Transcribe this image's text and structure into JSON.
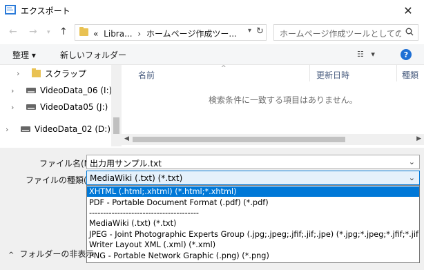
{
  "window": {
    "title": "エクスポート"
  },
  "nav": {
    "breadcrumb_prefix": "«",
    "crumbs": [
      "Libra...",
      "ホームページ作成ツー..."
    ],
    "search_placeholder": "ホームページ作成ツールとしてのLib..."
  },
  "toolbar": {
    "organize": "整理 ▾",
    "new_folder": "新しいフォルダー"
  },
  "sidebar": {
    "items": [
      {
        "label": "スクラップ",
        "type": "folder"
      },
      {
        "label": "VideoData_06 (I:)",
        "type": "drive"
      },
      {
        "label": "VideoData05 (J:)",
        "type": "drive"
      },
      {
        "label": "VideoData_02 (D:)",
        "type": "drive"
      }
    ]
  },
  "list": {
    "columns": [
      "名前",
      "更新日時",
      "種類"
    ],
    "empty_text": "検索条件に一致する項目はありません。"
  },
  "form": {
    "filename_label": "ファイル名(N):",
    "filename_value": "出力用サンプル.txt",
    "filetype_label": "ファイルの種類(T):",
    "filetype_value": "MediaWiki (.txt) (*.txt)"
  },
  "dropdown": {
    "options": [
      "XHTML (.html;.xhtml) (*.html;*.xhtml)",
      "PDF - Portable Document Format (.pdf) (*.pdf)",
      "---------------------------------------",
      "MediaWiki (.txt) (*.txt)",
      "JPEG - Joint Photographic Experts Group (.jpg;.jpeg;.jfif;.jif;.jpe) (*.jpg;*.jpeg;*.jfif;*.jif;*.jpe)",
      "Writer Layout XML (.xml) (*.xml)",
      "PNG - Portable Network Graphic (.png) (*.png)"
    ],
    "selected_index": 0
  },
  "footer": {
    "hide_folders": "フォルダーの非表示"
  }
}
